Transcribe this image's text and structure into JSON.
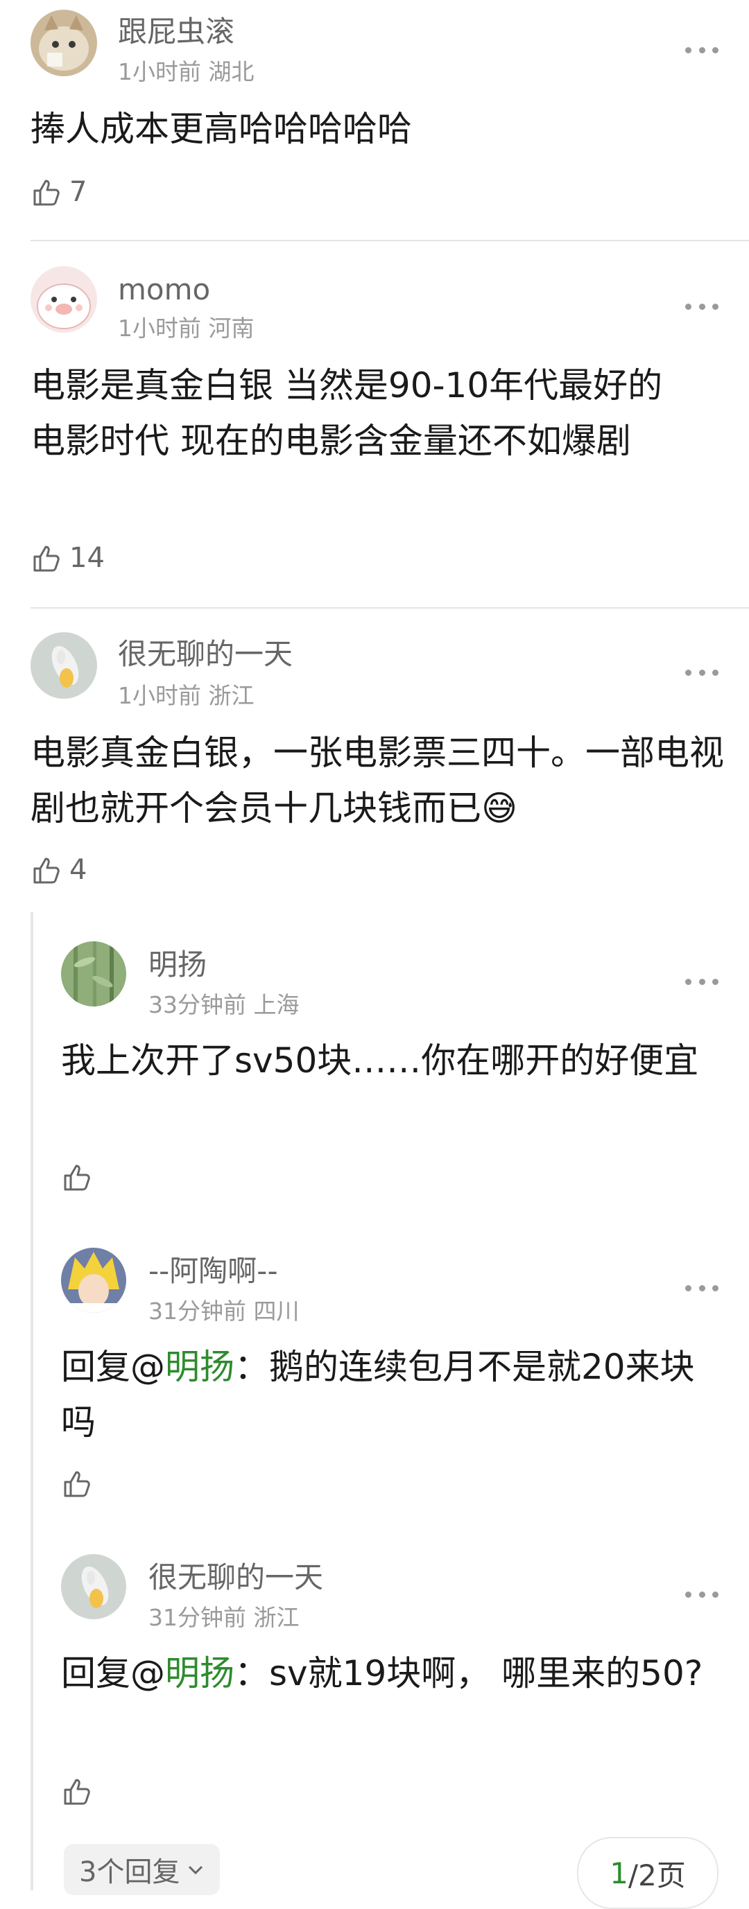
{
  "comments": [
    {
      "username": "跟屁虫滚",
      "time": "1小时前",
      "location": "湖北",
      "text": "捧人成本更高哈哈哈哈哈",
      "likes": "7",
      "avatar_icon": "cat-avatar-icon"
    },
    {
      "username": "momo",
      "time": "1小时前",
      "location": "河南",
      "text": "电影是真金白银 当然是90-10年代最好的电影时代 现在的电影含金量还不如爆剧",
      "likes": "14",
      "avatar_icon": "pig-avatar-icon"
    },
    {
      "username": "很无聊的一天",
      "time": "1小时前",
      "location": "浙江",
      "text": "电影真金白银，一张电影票三四十。一部电视剧也就开个会员十几块钱而已",
      "emoji": "😅",
      "likes": "4",
      "avatar_icon": "fish-avatar-icon"
    }
  ],
  "replies": [
    {
      "username": "明扬",
      "time": "33分钟前",
      "location": "上海",
      "text": "我上次开了sv50块……你在哪开的好便宜",
      "avatar_icon": "bamboo-avatar-icon"
    },
    {
      "username": "--阿陶啊--",
      "time": "31分钟前",
      "location": "四川",
      "reply_prefix": "回复@",
      "mention": "明扬",
      "text": "：鹅的连续包月不是就20来块吗",
      "avatar_icon": "anime-avatar-icon"
    },
    {
      "username": "很无聊的一天",
      "time": "31分钟前",
      "location": "浙江",
      "reply_prefix": "回复@",
      "mention": "明扬",
      "text": "：sv就19块啊， 哪里来的50?",
      "avatar_icon": "fish-avatar-icon"
    }
  ],
  "footer": {
    "replies_label": "3个回复",
    "page_current": "1",
    "page_rest": "/2页"
  },
  "colors": {
    "mention": "#2e8b2e",
    "meta": "#9a9a9a",
    "username": "#666666"
  }
}
